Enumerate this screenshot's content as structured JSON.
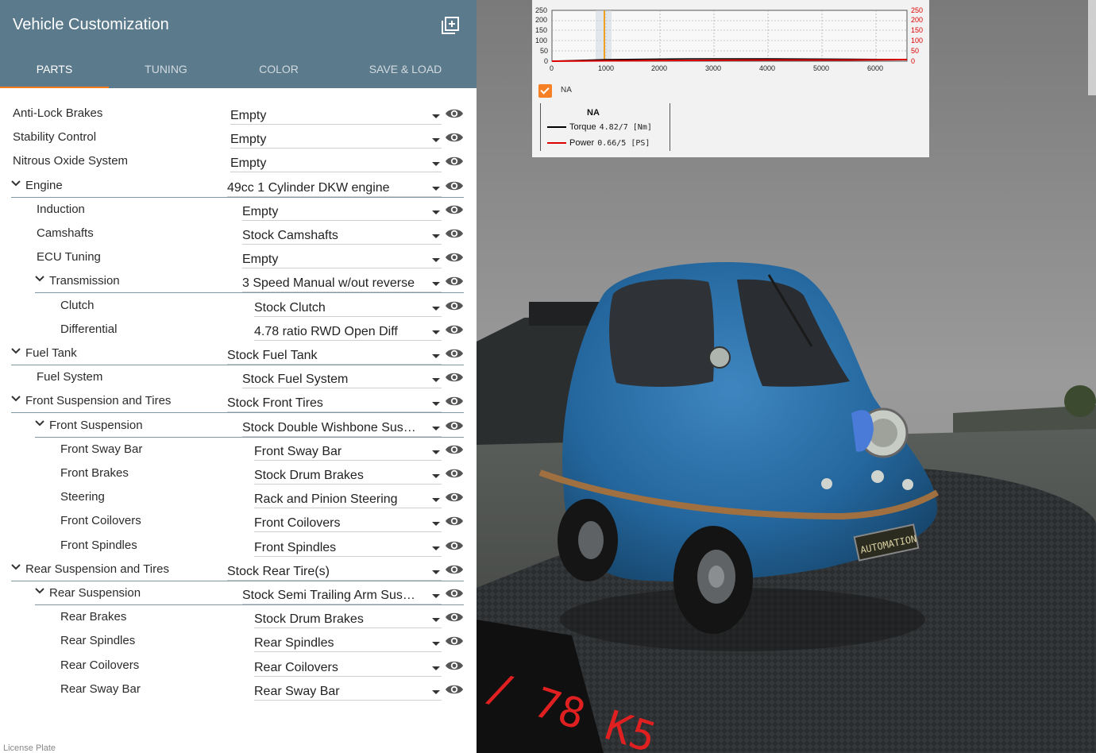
{
  "header": {
    "title": "Vehicle Customization"
  },
  "tabs": [
    {
      "label": "PARTS",
      "active": true
    },
    {
      "label": "TUNING",
      "active": false
    },
    {
      "label": "COLOR",
      "active": false
    },
    {
      "label": "SAVE & LOAD",
      "active": false
    }
  ],
  "parts": [
    {
      "label": "Anti-Lock Brakes",
      "value": "Empty",
      "level": 0,
      "expanded": false
    },
    {
      "label": "Stability Control",
      "value": "Empty",
      "level": 0,
      "expanded": false
    },
    {
      "label": "Nitrous Oxide System",
      "value": "Empty",
      "level": 0,
      "expanded": false
    },
    {
      "label": "Engine",
      "value": "49cc 1 Cylinder DKW engine",
      "level": 0,
      "expanded": true
    },
    {
      "label": "Induction",
      "value": "Empty",
      "level": 1,
      "expanded": false
    },
    {
      "label": "Camshafts",
      "value": "Stock Camshafts",
      "level": 1,
      "expanded": false
    },
    {
      "label": "ECU Tuning",
      "value": "Empty",
      "level": 1,
      "expanded": false
    },
    {
      "label": "Transmission",
      "value": "3 Speed Manual w/out reverse",
      "level": 1,
      "expanded": true
    },
    {
      "label": "Clutch",
      "value": "Stock Clutch",
      "level": 2,
      "expanded": false
    },
    {
      "label": "Differential",
      "value": "4.78 ratio RWD Open Diff",
      "level": 2,
      "expanded": false
    },
    {
      "label": "Fuel Tank",
      "value": "Stock Fuel Tank",
      "level": 0,
      "expanded": true
    },
    {
      "label": "Fuel System",
      "value": "Stock Fuel System",
      "level": 1,
      "expanded": false
    },
    {
      "label": "Front Suspension and Tires",
      "value": "Stock Front Tires",
      "level": 0,
      "expanded": true
    },
    {
      "label": "Front Suspension",
      "value": "Stock Double Wishbone Suspension",
      "level": 1,
      "expanded": true
    },
    {
      "label": "Front Sway Bar",
      "value": "Front Sway Bar",
      "level": 2,
      "expanded": false
    },
    {
      "label": "Front Brakes",
      "value": "Stock Drum Brakes",
      "level": 2,
      "expanded": false
    },
    {
      "label": "Steering",
      "value": "Rack and Pinion Steering",
      "level": 2,
      "expanded": false
    },
    {
      "label": "Front Coilovers",
      "value": "Front Coilovers",
      "level": 2,
      "expanded": false
    },
    {
      "label": "Front Spindles",
      "value": "Front Spindles",
      "level": 2,
      "expanded": false
    },
    {
      "label": "Rear Suspension and Tires",
      "value": "Stock Rear Tire(s)",
      "level": 0,
      "expanded": true
    },
    {
      "label": "Rear Suspension",
      "value": "Stock Semi Trailing Arm Suspension",
      "level": 1,
      "expanded": true
    },
    {
      "label": "Rear Brakes",
      "value": "Stock Drum Brakes",
      "level": 2,
      "expanded": false
    },
    {
      "label": "Rear Spindles",
      "value": "Rear Spindles",
      "level": 2,
      "expanded": false
    },
    {
      "label": "Rear Coilovers",
      "value": "Rear Coilovers",
      "level": 2,
      "expanded": false
    },
    {
      "label": "Rear Sway Bar",
      "value": "Rear Sway Bar",
      "level": 2,
      "expanded": false
    }
  ],
  "footer": {
    "label": "License Plate"
  },
  "graph": {
    "y_left_ticks": [
      "250",
      "200",
      "150",
      "100",
      "50",
      "0"
    ],
    "y_right_ticks": [
      "250",
      "200",
      "150",
      "100",
      "50",
      "0"
    ],
    "x_ticks": [
      "0",
      "1000",
      "2000",
      "3000",
      "4000",
      "5000",
      "6000"
    ],
    "series_checkbox_label": "NA",
    "legend_title": "NA",
    "torque_label": "Torque",
    "torque_value": "4.82/7 [Nm]",
    "power_label": "Power",
    "power_value": "0.66/5 [PS]",
    "colors": {
      "torque": "#000000",
      "power": "#dd0000",
      "cursor": "#f0a020"
    }
  },
  "scene": {
    "plate_text": "AUTOMATION",
    "display_text": "/ 78 K5"
  }
}
